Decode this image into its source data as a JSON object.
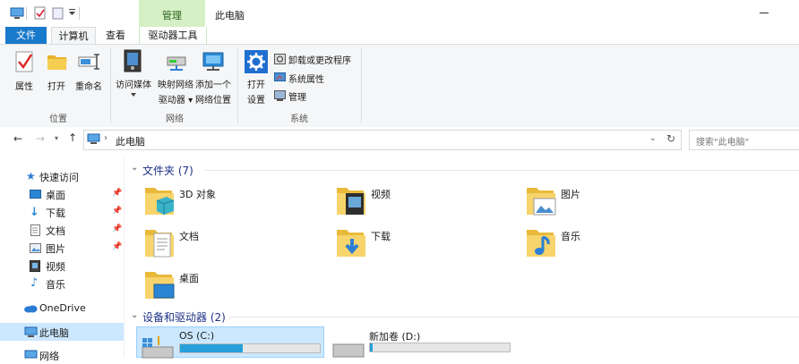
{
  "window": {
    "title": "此电脑"
  },
  "ribbon_tabs": {
    "context_group": "管理",
    "file": "文件",
    "computer": "计算机",
    "view": "查看",
    "drive_tools": "驱动器工具"
  },
  "ribbon": {
    "location": {
      "group_label": "位置",
      "properties": "属性",
      "open": "打开",
      "rename": "重命名"
    },
    "network": {
      "group_label": "网络",
      "access_media": "访问媒体",
      "map_drive_1": "映射网络",
      "map_drive_2": "驱动器",
      "add_location_1": "添加一个",
      "add_location_2": "网络位置"
    },
    "system": {
      "group_label": "系统",
      "open_settings_1": "打开",
      "open_settings_2": "设置",
      "uninstall": "卸载或更改程序",
      "sys_props": "系统属性",
      "manage": "管理"
    }
  },
  "address": {
    "path": "此电脑",
    "search_placeholder": "搜索\"此电脑\""
  },
  "nav": {
    "quick_access": "快速访问",
    "desktop": "桌面",
    "downloads": "下载",
    "documents": "文档",
    "pictures": "图片",
    "videos": "视频",
    "music": "音乐",
    "onedrive": "OneDrive",
    "this_pc": "此电脑",
    "network": "网络"
  },
  "content": {
    "folders_header": "文件夹 (7)",
    "folders": [
      "3D 对象",
      "视频",
      "图片",
      "文档",
      "下载",
      "音乐",
      "桌面"
    ],
    "devices_header": "设备和驱动器 (2)",
    "drives": [
      {
        "name": "OS (C:)",
        "fill": 0.45
      },
      {
        "name": "新加卷 (D:)",
        "fill": 0.02
      }
    ]
  },
  "colors": {
    "file_tab": "#1979ca",
    "context_tab": "#d4f0c4",
    "selection": "#cce8ff",
    "drive_bar": "#26a0da"
  }
}
